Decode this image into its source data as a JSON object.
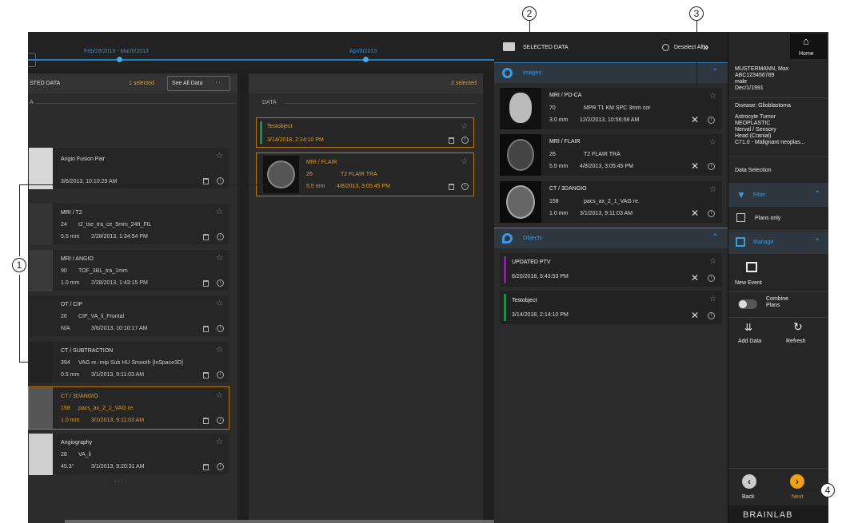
{
  "timeline": {
    "range1": "Feb/28/2013 - Mar/6/2013",
    "range2": "Apr/8/2013"
  },
  "left_col": {
    "title": "STED DATA",
    "selected": "1 selected",
    "see_all": "See All Data",
    "more": "· · ·",
    "section": "A",
    "items": [
      {
        "title": "Angio Fusion Pair",
        "line1": "",
        "line2": "3/6/2013, 10:10:29 AM"
      },
      {
        "title": "MRI / T2",
        "line1a": "24",
        "line1b": "t2_tse_tra_ce_5mm_24ft_FIL",
        "line2a": "5.5 mm",
        "line2b": "2/28/2013, 1:34:54 PM"
      },
      {
        "title": "MRI / ANGIO",
        "line1a": "90",
        "line1b": "TOF_3BL_tra_1mm",
        "line2a": "1.0 mm",
        "line2b": "2/28/2013, 1:43:15 PM"
      },
      {
        "title": "OT / CIP",
        "line1a": "26",
        "line1b": "CIP_VA_li_Frontal",
        "line2a": "N/A",
        "line2b": "3/6/2013, 10:10:17 AM"
      },
      {
        "title": "CT / SUBTRACTION",
        "line1a": "394",
        "line1b": "VAG re.-mip Sub HU Smooth [InSpace3D]",
        "line2a": "0.5 mm",
        "line2b": "3/1/2013, 9:11:03 AM"
      },
      {
        "title": "CT / 3DANGIO",
        "line1a": "158",
        "line1b": "pacs_ax_2_1_VAG re.",
        "line2a": "1.0 mm",
        "line2b": "3/1/2013, 9:11:03 AM"
      },
      {
        "title": "Angiography",
        "line1a": "28",
        "line1b": "VA_li",
        "line2a": "45.3°",
        "line2b": "3/1/2013, 9:20:31 AM"
      }
    ],
    "ellipsis": "· · ·"
  },
  "mid_col": {
    "selected": "2 selected",
    "section": "DATA",
    "obj": {
      "title": "Testobject",
      "date": "3/14/2018, 2:14:10 PM"
    },
    "img": {
      "title": "MRI / FLAIR",
      "line1a": "26",
      "line1b": "T2 FLAIR TRA",
      "line2a": "5.5 mm",
      "line2b": "4/8/2013, 3:05:45 PM"
    }
  },
  "sel_panel": {
    "title": "SELECTED DATA",
    "deselect": "Deselect All",
    "images_label": "Images",
    "images": [
      {
        "title": "MRI / PD-CA",
        "line1a": "70",
        "line1b": "MPR T1 KM SPC 3mm cor",
        "line2a": "3.0 mm",
        "line2b": "12/2/2013, 10:56:58 AM"
      },
      {
        "title": "MRI / FLAIR",
        "line1a": "26",
        "line1b": "T2 FLAIR TRA",
        "line2a": "5.5 mm",
        "line2b": "4/8/2013, 3:05:45 PM"
      },
      {
        "title": "CT / 3DANGIO",
        "line1a": "158",
        "line1b": "pacs_ax_2_1_VAG re.",
        "line2a": "1.0 mm",
        "line2b": "3/1/2013, 9:11:03 AM"
      }
    ],
    "objects_label": "Objects",
    "objects": [
      {
        "title": "UPDATED PTV",
        "date": "8/20/2018, 5:43:53 PM",
        "color": "#7b2a8c"
      },
      {
        "title": "Testobject",
        "date": "3/14/2018, 2:14:10 PM",
        "color": "#1f8a4c"
      }
    ]
  },
  "sidebar": {
    "home": "Home",
    "patient": [
      "MUSTERMANN, Max",
      "ABC123456789",
      "male",
      "Dec/1/1991"
    ],
    "disease": "Disease:  Glioblastoma",
    "diag": [
      "Astrocyte Tumor",
      "NEOPLASTIC",
      "Nerval / Sensory",
      "Head (Cranial)",
      "C71.0 - Malignant neoplas..."
    ],
    "data_selection": "Data Selection",
    "filter": "Filter",
    "plans_only": "Plans only",
    "manage": "Manage",
    "new_event": "New Event",
    "combine": "Combine Plans",
    "add_data": "Add Data",
    "refresh": "Refresh",
    "back": "Back",
    "next": "Next",
    "brand": "BRAINLAB"
  },
  "annotations": [
    "1",
    "2",
    "3",
    "4"
  ]
}
